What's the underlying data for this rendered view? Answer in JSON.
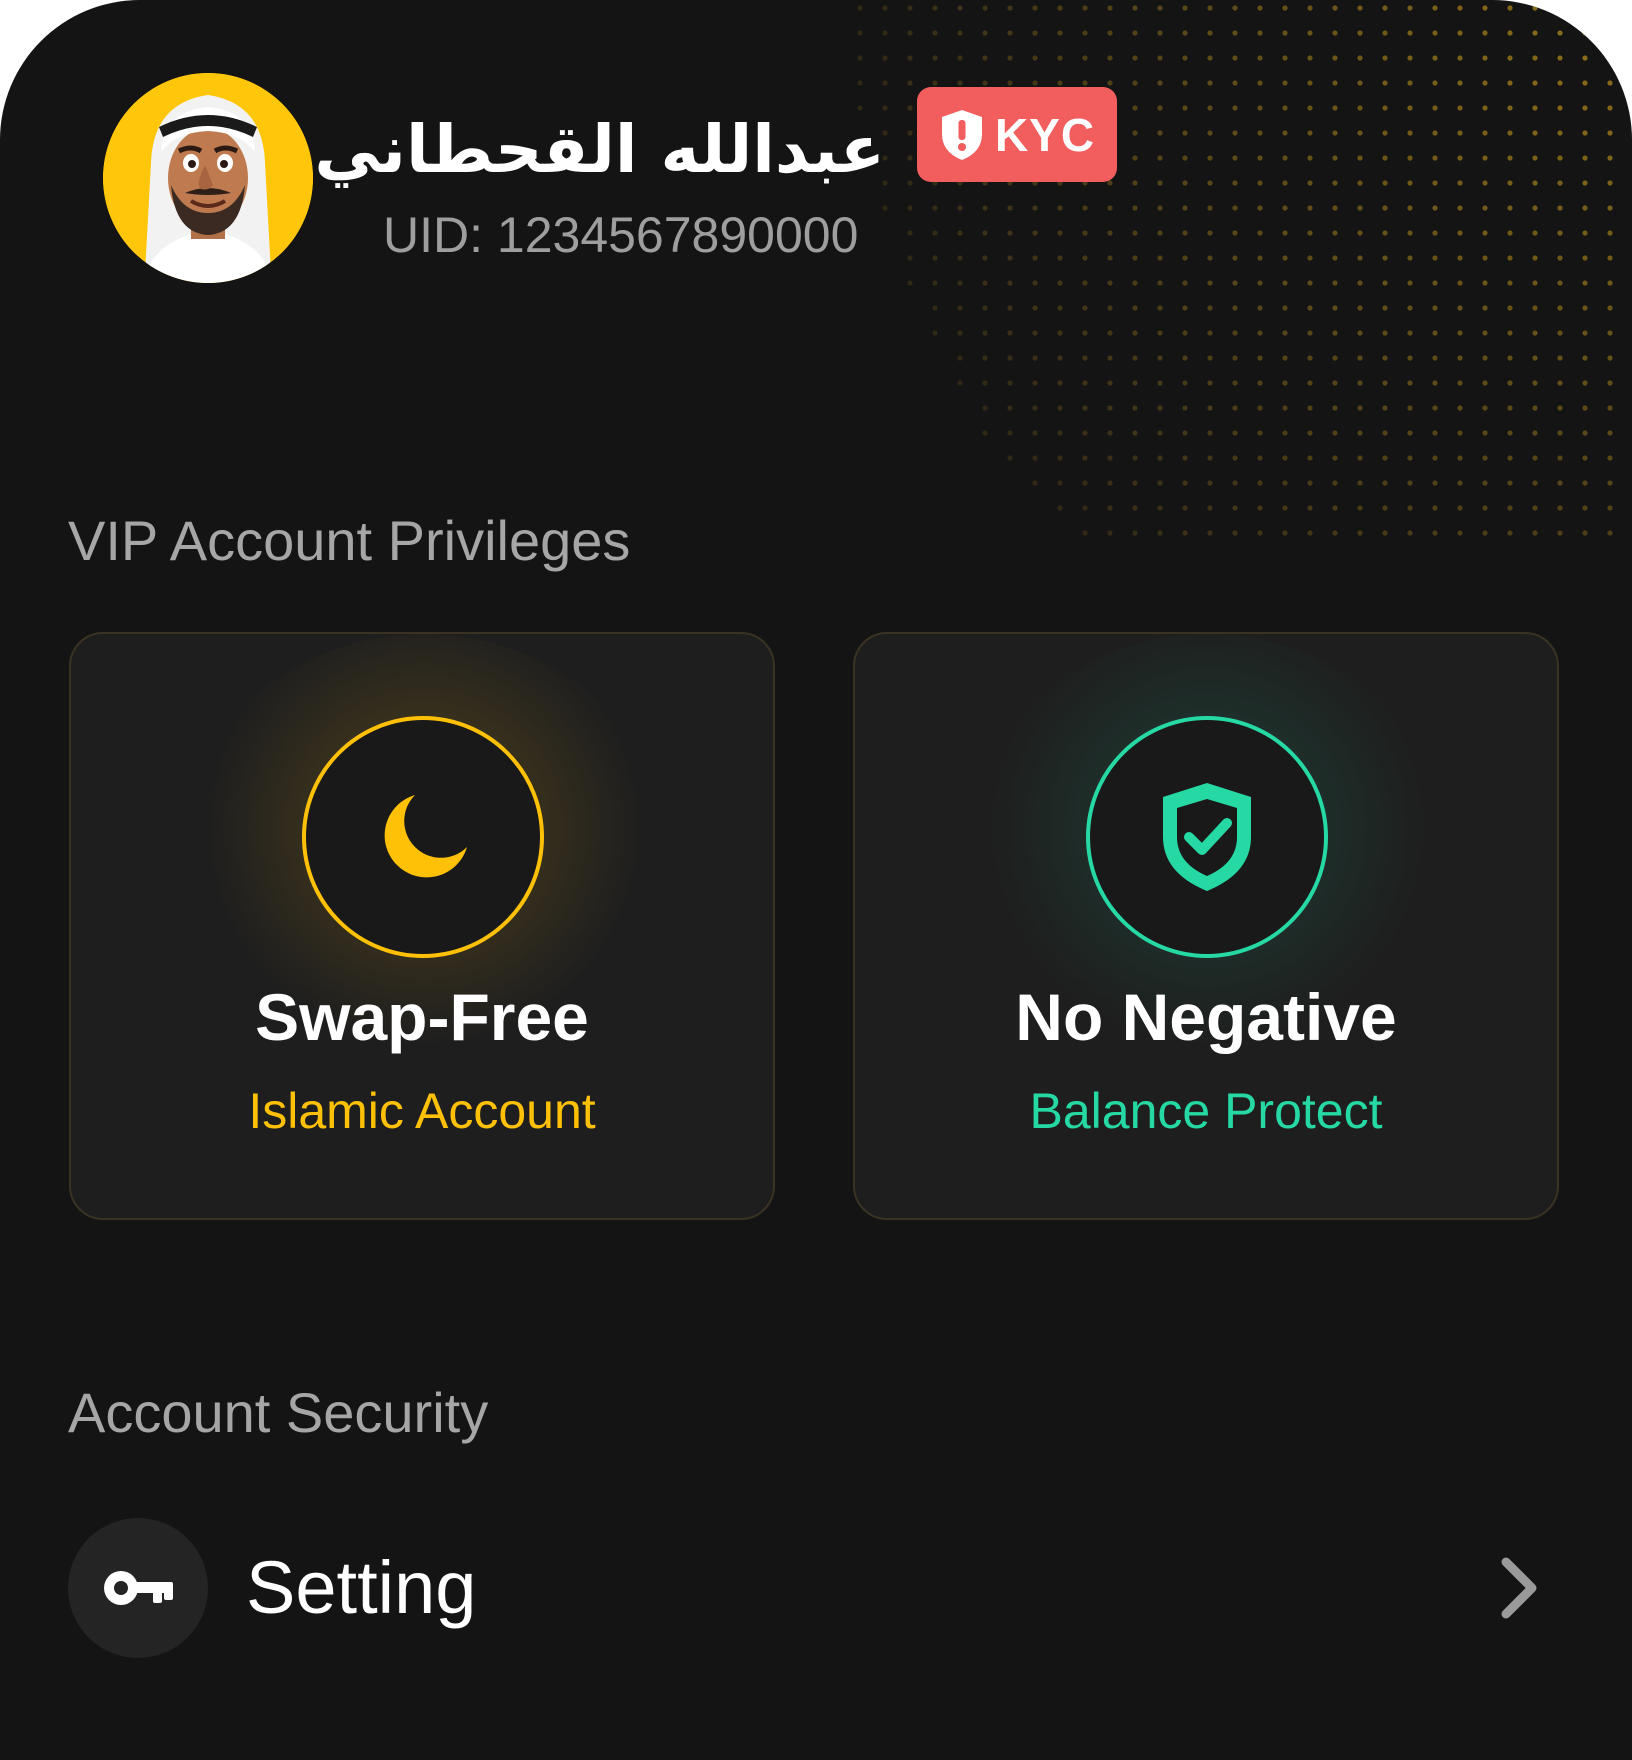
{
  "profile": {
    "name": "عبدالله القحطاني",
    "uid": "UID: 1234567890000",
    "kyc_label": "KYC",
    "avatar_icon": "arab-man-avatar"
  },
  "vip_section": {
    "title": "VIP Account Privileges",
    "cards": [
      {
        "title": "Swap-Free",
        "subtitle": "Islamic Account",
        "icon": "crescent-moon-icon",
        "accent": "#ffc107"
      },
      {
        "title": "No Negative",
        "subtitle": "Balance Protect",
        "icon": "shield-check-icon",
        "accent": "#26d9a4"
      }
    ]
  },
  "security_section": {
    "title": "Account Security",
    "items": [
      {
        "label": "Setting",
        "icon": "key-icon"
      }
    ]
  },
  "colors": {
    "background": "#141414",
    "card": "#1e1e1e",
    "kyc_badge": "#f25d5d",
    "gold": "#ffc107",
    "green": "#26d9a4"
  }
}
